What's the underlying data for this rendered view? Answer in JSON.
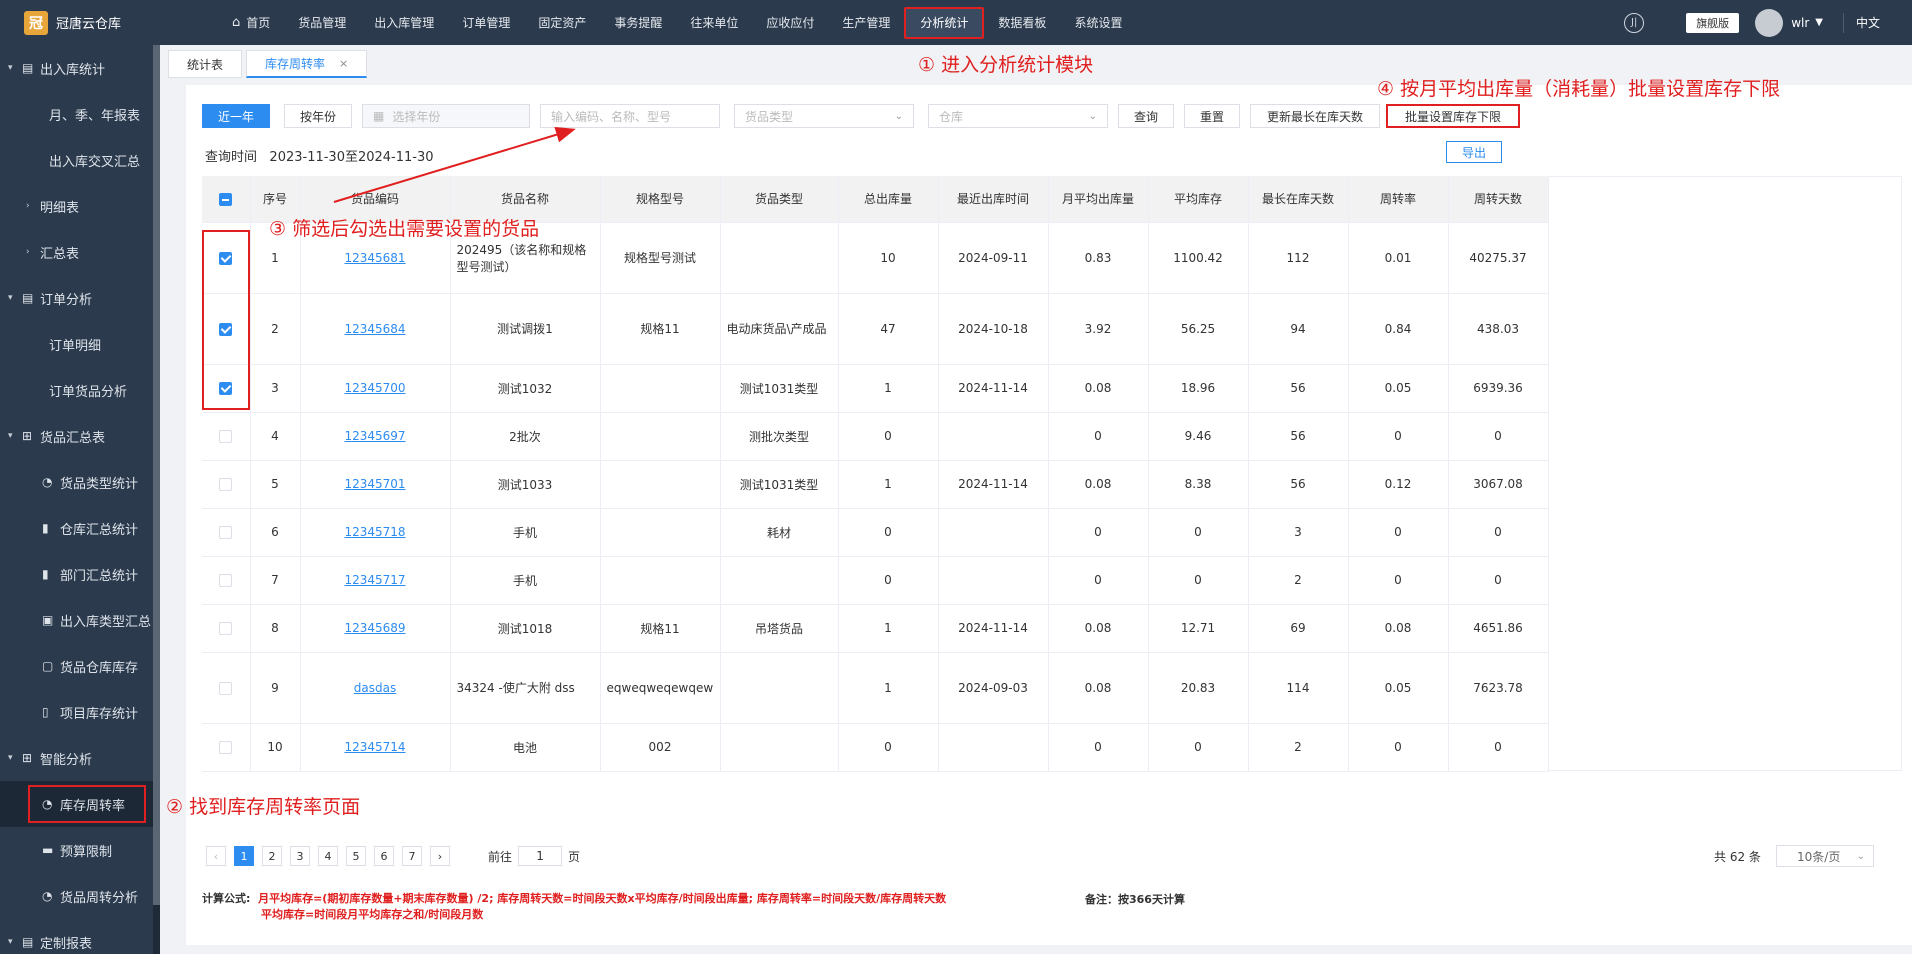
{
  "app": {
    "name": "冠唐云仓库",
    "logo_char": "冠"
  },
  "nav": {
    "home": "首页",
    "items": [
      "货品管理",
      "出入库管理",
      "订单管理",
      "固定资产",
      "事务提醒",
      "往来单位",
      "应收应付",
      "生产管理",
      "分析统计",
      "数据看板",
      "系统设置"
    ],
    "active": "分析统计"
  },
  "topright": {
    "icon": "help-circle-icon",
    "edition": "旗舰版",
    "user": "wlr",
    "lang": "中文"
  },
  "sidebar": {
    "g1": "出入库统计",
    "g1_items": [
      "月、季、年报表",
      "出入库交叉汇总"
    ],
    "g1_sub1": "明细表",
    "g1_sub2": "汇总表",
    "g2": "订单分析",
    "g2_items": [
      "订单明细",
      "订单货品分析"
    ],
    "g3": "货品汇总表",
    "g3_items": [
      "货品类型统计",
      "仓库汇总统计",
      "部门汇总统计",
      "出入库类型汇总",
      "货品仓库库存",
      "项目库存统计"
    ],
    "g4": "智能分析",
    "g4_items": [
      "库存周转率",
      "预算限制",
      "货品周转分析"
    ],
    "g5": "定制报表"
  },
  "tabs": {
    "t1": "统计表",
    "t2": "库存周转率"
  },
  "toolbar": {
    "btn_year": "近一年",
    "btn_month": "按年份",
    "year_placeholder": "选择年份",
    "search_placeholder": "输入编码、名称、型号",
    "type_placeholder": "货品类型",
    "warehouse_placeholder": "仓库",
    "query": "查询",
    "reset": "重置",
    "update_days": "更新最长在库天数",
    "batch_set": "批量设置库存下限",
    "export": "导出"
  },
  "query_time": {
    "label": "查询时间",
    "value": "2023-11-30至2024-11-30"
  },
  "table": {
    "headers": [
      "序号",
      "货品编码",
      "货品名称",
      "规格型号",
      "货品类型",
      "总出库量",
      "最近出库时间",
      "月平均出库量",
      "平均库存",
      "最长在库天数",
      "周转率",
      "周转天数"
    ],
    "rows": [
      {
        "checked": true,
        "no": "1",
        "code": "12345681",
        "name": "202495（该名称和规格型号测试）",
        "spec": "规格型号测试",
        "type": "",
        "out": "10",
        "last": "2024-09-11",
        "avg_out": "0.83",
        "avg_stock": "1100.42",
        "max_days": "112",
        "rate": "0.01",
        "turn_days": "40275.37"
      },
      {
        "checked": true,
        "no": "2",
        "code": "12345684",
        "name": "测试调拨1",
        "spec": "规格11",
        "type": "电动床货品\\产成品",
        "out": "47",
        "last": "2024-10-18",
        "avg_out": "3.92",
        "avg_stock": "56.25",
        "max_days": "94",
        "rate": "0.84",
        "turn_days": "438.03"
      },
      {
        "checked": true,
        "no": "3",
        "code": "12345700",
        "name": "测试1032",
        "spec": "",
        "type": "测试1031类型",
        "out": "1",
        "last": "2024-11-14",
        "avg_out": "0.08",
        "avg_stock": "18.96",
        "max_days": "56",
        "rate": "0.05",
        "turn_days": "6939.36"
      },
      {
        "checked": false,
        "no": "4",
        "code": "12345697",
        "name": "2批次",
        "spec": "",
        "type": "测批次类型",
        "out": "0",
        "last": "",
        "avg_out": "0",
        "avg_stock": "9.46",
        "max_days": "56",
        "rate": "0",
        "turn_days": "0"
      },
      {
        "checked": false,
        "no": "5",
        "code": "12345701",
        "name": "测试1033",
        "spec": "",
        "type": "测试1031类型",
        "out": "1",
        "last": "2024-11-14",
        "avg_out": "0.08",
        "avg_stock": "8.38",
        "max_days": "56",
        "rate": "0.12",
        "turn_days": "3067.08"
      },
      {
        "checked": false,
        "no": "6",
        "code": "12345718",
        "name": "手机",
        "spec": "",
        "type": "耗材",
        "out": "0",
        "last": "",
        "avg_out": "0",
        "avg_stock": "0",
        "max_days": "3",
        "rate": "0",
        "turn_days": "0"
      },
      {
        "checked": false,
        "no": "7",
        "code": "12345717",
        "name": "手机",
        "spec": "",
        "type": "",
        "out": "0",
        "last": "",
        "avg_out": "0",
        "avg_stock": "0",
        "max_days": "2",
        "rate": "0",
        "turn_days": "0"
      },
      {
        "checked": false,
        "no": "8",
        "code": "12345689",
        "name": "测试1018",
        "spec": "规格11",
        "type": "吊塔货品",
        "out": "1",
        "last": "2024-11-14",
        "avg_out": "0.08",
        "avg_stock": "12.71",
        "max_days": "69",
        "rate": "0.08",
        "turn_days": "4651.86"
      },
      {
        "checked": false,
        "no": "9",
        "code": "dasdas",
        "name": "34324 -使广大附 dss",
        "spec": "eqweqweqewqew",
        "type": "",
        "out": "1",
        "last": "2024-09-03",
        "avg_out": "0.08",
        "avg_stock": "20.83",
        "max_days": "114",
        "rate": "0.05",
        "turn_days": "7623.78"
      },
      {
        "checked": false,
        "no": "10",
        "code": "12345714",
        "name": "电池",
        "spec": "002",
        "type": "",
        "out": "0",
        "last": "",
        "avg_out": "0",
        "avg_stock": "0",
        "max_days": "2",
        "rate": "0",
        "turn_days": "0"
      }
    ]
  },
  "pager": {
    "pages": [
      "1",
      "2",
      "3",
      "4",
      "5",
      "6",
      "7"
    ],
    "current": "1",
    "goto_label": "前往",
    "goto_value": "1",
    "page_suffix": "页",
    "total": "共 62 条",
    "page_size": "10条/页"
  },
  "formula": {
    "label": "计算公式:",
    "line1": "月平均库存=(期初库存数量+期末库存数量) /2; 库存周转天数=时间段天数x平均库存/时间段出库量; 库存周转率=时间段天数/库存周转天数",
    "line2": "平均库存=时间段月平均库存之和/时间段月数",
    "remark": "备注：按366天计算"
  },
  "annotations": {
    "a1": "① 进入分析统计模块",
    "a2": "② 找到库存周转率页面",
    "a3": "③ 筛选后勾选出需要设置的货品",
    "a4": "④ 按月平均出库量（消耗量）批量设置库存下限"
  },
  "colors": {
    "primary": "#2d8cf0",
    "annotation": "#e02020",
    "sidebar": "#2b3a4d"
  }
}
